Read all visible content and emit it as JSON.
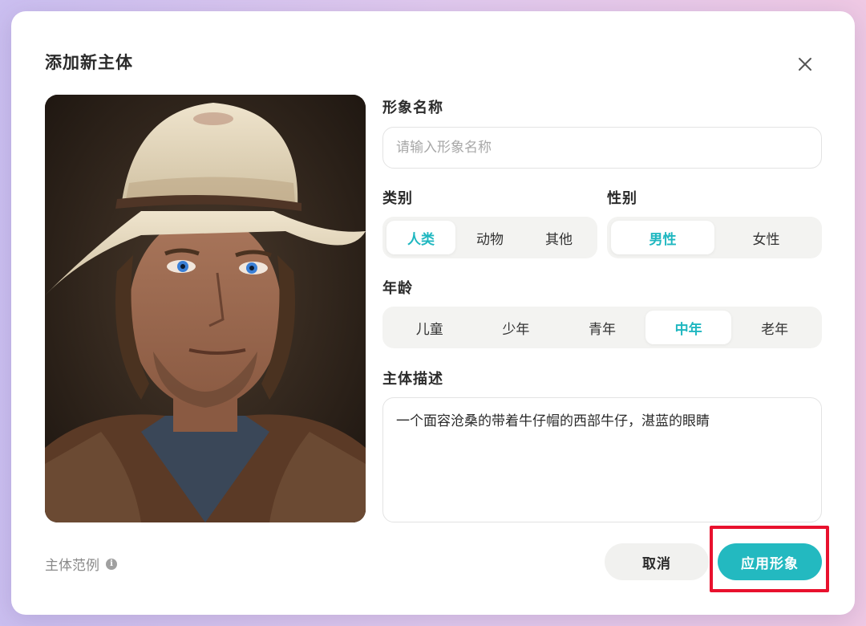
{
  "dialog": {
    "title": "添加新主体"
  },
  "fields": {
    "name": {
      "label": "形象名称",
      "placeholder": "请输入形象名称",
      "value": ""
    },
    "category": {
      "label": "类别",
      "options": [
        "人类",
        "动物",
        "其他"
      ],
      "selected": "人类"
    },
    "gender": {
      "label": "性别",
      "options": [
        "男性",
        "女性"
      ],
      "selected": "男性"
    },
    "age": {
      "label": "年龄",
      "options": [
        "儿童",
        "少年",
        "青年",
        "中年",
        "老年"
      ],
      "selected": "中年"
    },
    "description": {
      "label": "主体描述",
      "value": "一个面容沧桑的带着牛仔帽的西部牛仔，湛蓝的眼睛"
    }
  },
  "footer": {
    "example_label": "主体范例",
    "cancel_label": "取消",
    "apply_label": "应用形象"
  },
  "colors": {
    "accent": "#23b9c0",
    "highlight": "#e8112d"
  },
  "icons": {
    "close": "close-icon",
    "info": "info-icon"
  }
}
